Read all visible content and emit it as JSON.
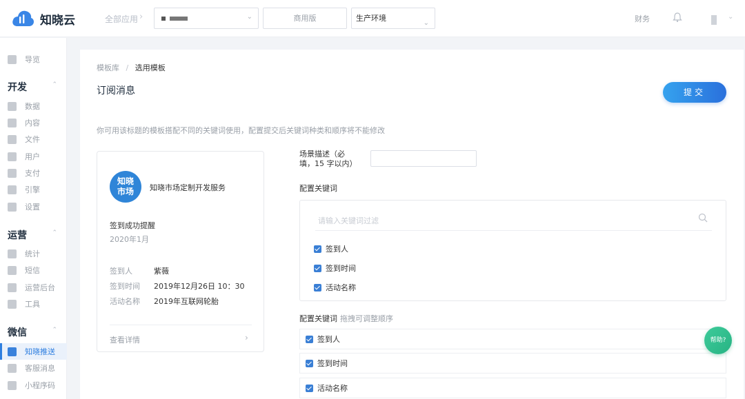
{
  "header": {
    "logo_text": "知晓云",
    "all_apps": "全部应用",
    "edition": "商用版",
    "environment": "生产环境",
    "finance": "财务",
    "icons": [
      "cloud-logo-icon",
      "chevron-right-icon",
      "chevron-down-icon",
      "bell-icon"
    ]
  },
  "sidebar": {
    "overview": "导览",
    "groups": {
      "dev": "开发",
      "ops": "运营",
      "wechat": "微信"
    },
    "dev_items": [
      "数据",
      "内容",
      "文件",
      "用户",
      "支付",
      "引擎",
      "设置"
    ],
    "ops_items": [
      "统计",
      "短信",
      "运营后台",
      "工具"
    ],
    "wechat_items": [
      "知晓推送",
      "客服消息",
      "小程序码"
    ],
    "active_item": "知晓推送",
    "accent_color": "#2f7fe0"
  },
  "main": {
    "breadcrumb": {
      "parent": "模板库",
      "separator": "/",
      "current": "选用模板"
    },
    "title": "订阅消息",
    "submit": "提交",
    "hint": "你可用该标题的模板搭配不同的关键词使用，配置提交后关键词种类和顺序将不能修改",
    "preview": {
      "brand_logo_line1": "知晓",
      "brand_logo_line2": "市场",
      "brand_name": "知晓市场定制开发服务",
      "message_title": "签到成功提醒",
      "message_date": "2020年1月",
      "fields": [
        {
          "key": "签到人",
          "value": "紫薇"
        },
        {
          "key": "签到时间",
          "value": "2019年12月26日 10：30"
        },
        {
          "key": "活动名称",
          "value": "2019年互联网轮胎"
        }
      ],
      "detail_link": "查看详情"
    },
    "form": {
      "scene_label": "场景描述（必填，15 字以内）",
      "scene_value": "",
      "keyword_label": "配置关键词",
      "search_placeholder": "请输入关键词过滤",
      "keyword_options": [
        "签到人",
        "签到时间",
        "活动名称"
      ],
      "order_label": "配置关键词",
      "order_hint": "拖拽可调整顺序",
      "order_items": [
        "签到人",
        "签到时间",
        "活动名称"
      ]
    },
    "help": "帮助?"
  }
}
